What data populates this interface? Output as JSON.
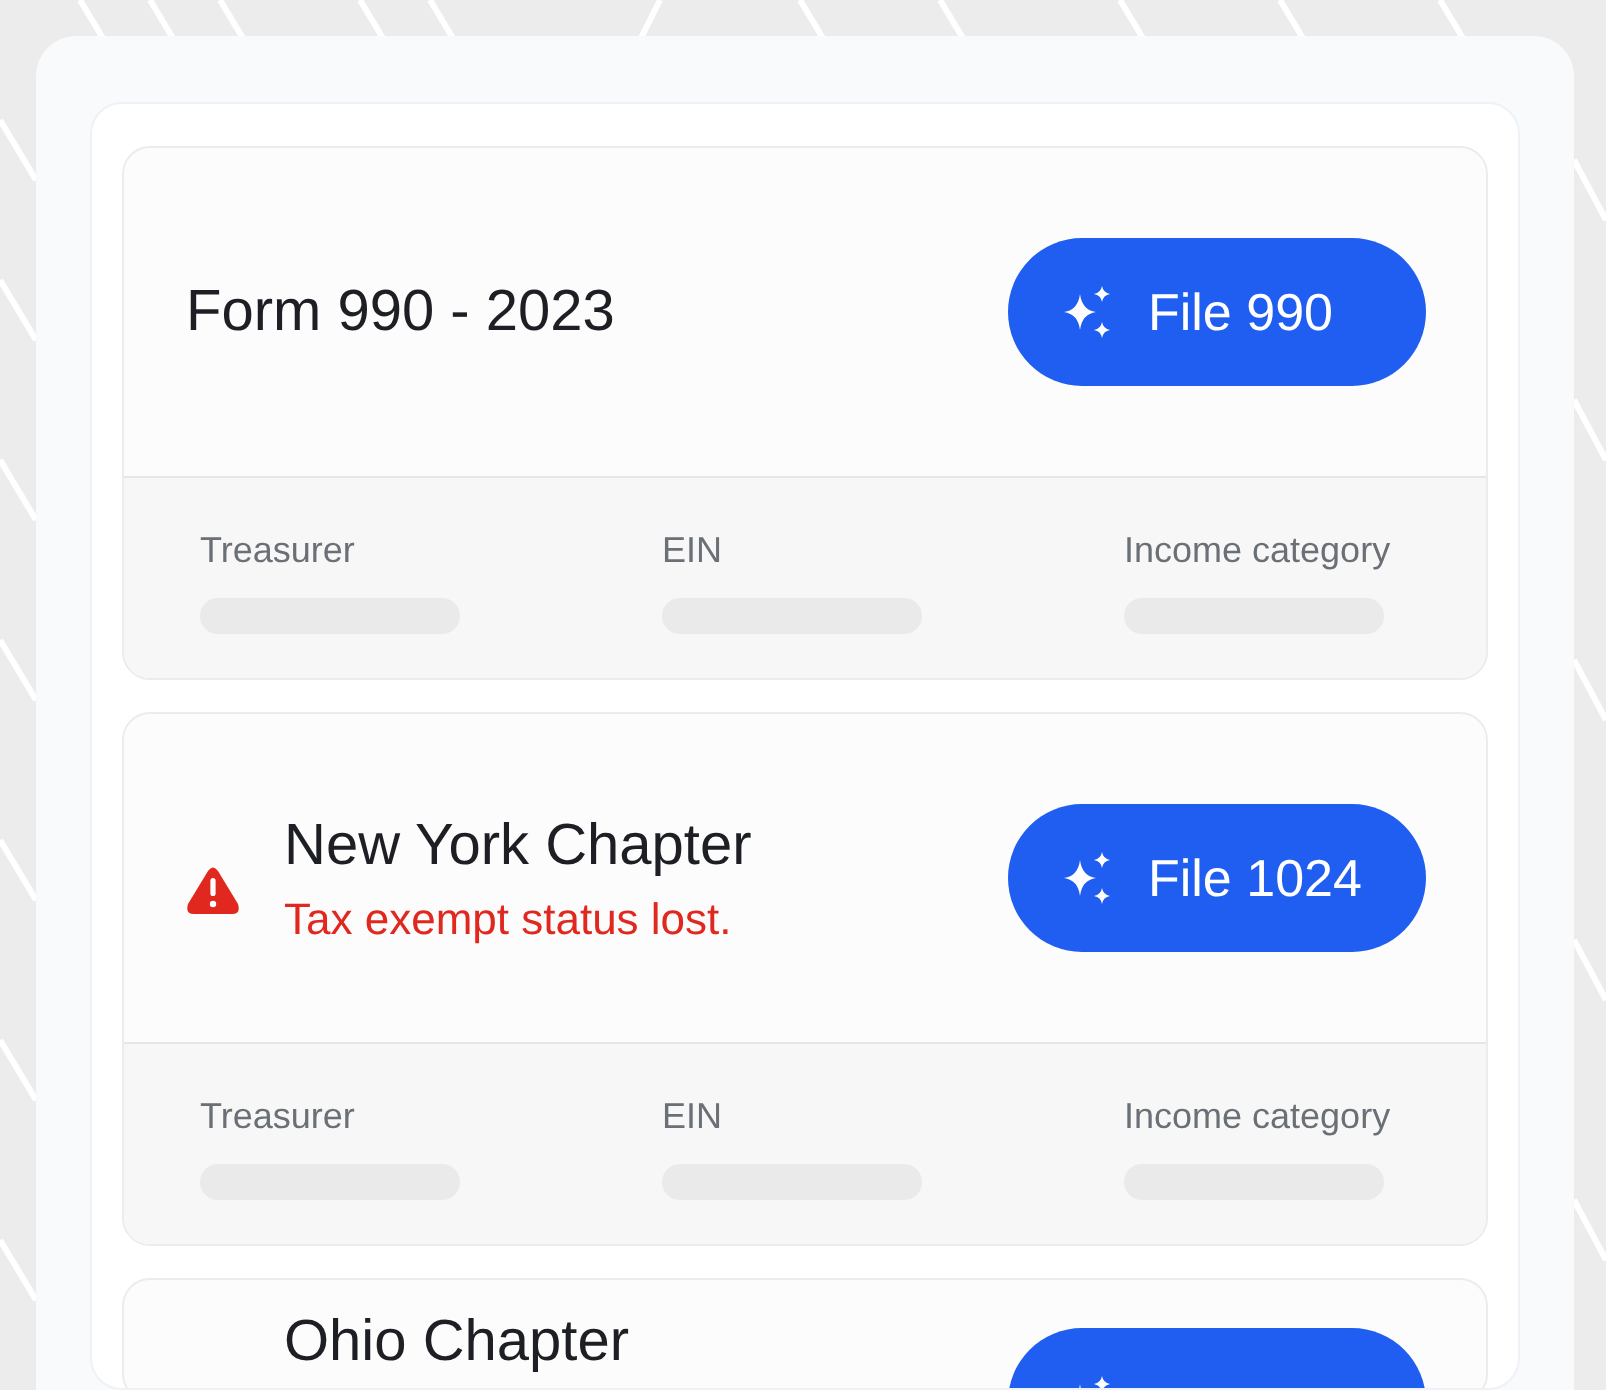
{
  "cards": [
    {
      "kind": "plain",
      "title": "Form 990 - 2023",
      "button": "File 990",
      "fields": [
        "Treasurer",
        "EIN",
        "Income category"
      ]
    },
    {
      "kind": "alert",
      "title": "New York Chapter",
      "message": "Tax exempt status lost.",
      "button": "File 1024",
      "fields": [
        "Treasurer",
        "EIN",
        "Income category"
      ]
    },
    {
      "kind": "alert",
      "title": "Ohio Chapter"
    }
  ]
}
